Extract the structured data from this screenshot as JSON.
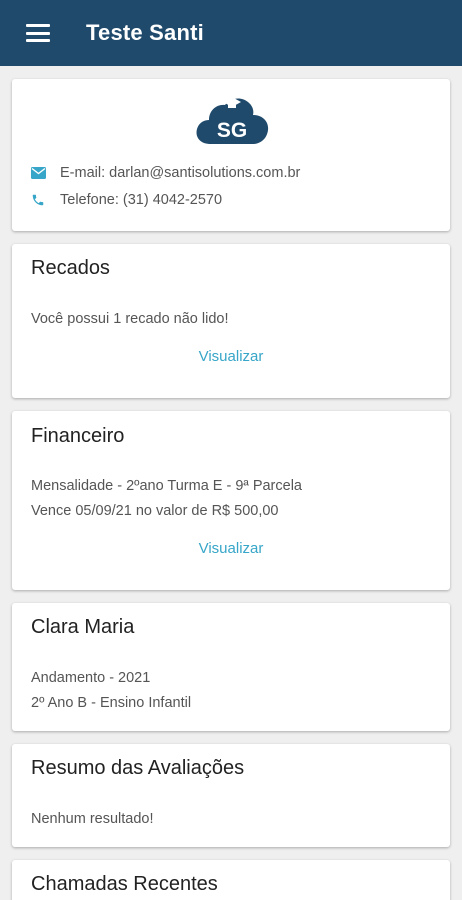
{
  "appbar": {
    "title": "Teste Santi",
    "menu_icon": "hamburger-menu-icon"
  },
  "contact": {
    "logo_text": "SG",
    "email_label": "E-mail: darlan@santisolutions.com.br",
    "phone_label": "Telefone: (31) 4042-2570"
  },
  "recados": {
    "title": "Recados",
    "message": "Você possui 1 recado não lido!",
    "action": "Visualizar"
  },
  "financeiro": {
    "title": "Financeiro",
    "line1": "Mensalidade - 2ºano Turma E - 9ª Parcela",
    "line2": "Vence 05/09/21 no valor de R$ 500,00",
    "action": "Visualizar"
  },
  "student": {
    "name": "Clara Maria",
    "line1": "Andamento - 2021",
    "line2": "2º Ano B - Ensino Infantil"
  },
  "avaliacoes": {
    "title": "Resumo das Avaliações",
    "message": "Nenhum resultado!"
  },
  "chamadas": {
    "title": "Chamadas Recentes"
  },
  "colors": {
    "appbar": "#1f4a6c",
    "accent": "#37a6c8",
    "logo": "#1f4a6c"
  }
}
